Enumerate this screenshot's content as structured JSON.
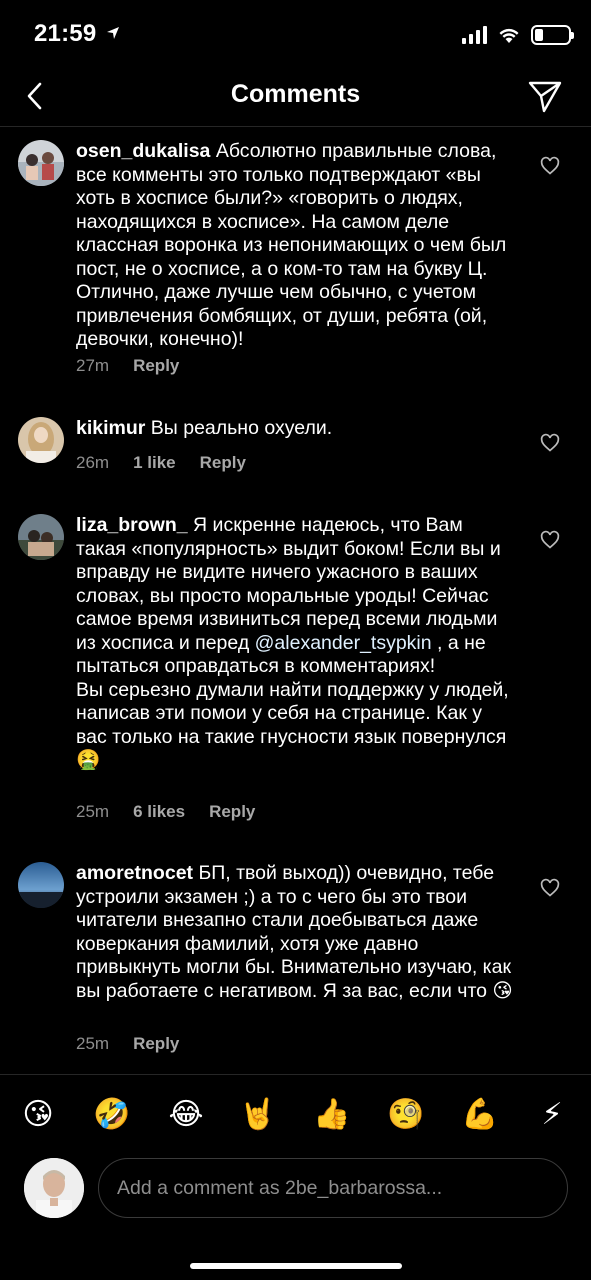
{
  "status_bar": {
    "time": "21:59",
    "battery_level": 0.25
  },
  "header": {
    "title": "Comments"
  },
  "comments": [
    {
      "user": "osen_dukalisa",
      "text": "Абсолютно правильные слова, все комменты это только подтверждают «вы хоть в хосписе были?» «говорить о людях, находящихся в хосписе». На самом деле классная воронка из непонимающих о чем был пост, не о хосписе, а о ком-то там на букву Ц. Отлично, даже лучше чем обычно, с учетом привлечения бомбящих, от души, ребята (ой, девочки, конечно)!",
      "time": "27m",
      "likes": "",
      "reply_label": "Reply"
    },
    {
      "user": "kikimur",
      "text": "Вы реально охуели.",
      "time": "26m",
      "likes": "1 like",
      "reply_label": "Reply"
    },
    {
      "user": "liza_brown_",
      "text": "Я искренне надеюсь, что Вам такая «популярность» выдит боком! Если вы и вправду не видите ничего ужасного в ваших словах, вы просто моральные уроды! Сейчас самое время извиниться перед всеми людьми из хосписа и перед",
      "mention": "@alexander_tsypkin",
      "text_after_mention": " , а не пытаться оправдаться в комментариях!",
      "text_2": "Вы серьезно думали найти поддержку у людей, написав эти помои у себя на странице. Как у вас только на такие гнусности язык повернулся🤮",
      "time": "25m",
      "likes": "6 likes",
      "reply_label": "Reply"
    },
    {
      "user": "amoretnocet",
      "text": "БП, твой выход)) очевидно, тебе устроили экзамен ;) а то с чего бы это твои читатели внезапно стали доебываться даже коверкания фамилий, хотя уже давно привыкнуть могли бы. Внимательно изучаю, как вы работаете с негативом. Я за вас, если что 😘",
      "time": "25m",
      "likes": "",
      "reply_label": "Reply"
    }
  ],
  "emoji_bar": [
    "😘",
    "🤣",
    "😂",
    "🤘",
    "👍",
    "🧐",
    "💪",
    "⚡"
  ],
  "composer": {
    "placeholder": "Add a comment as 2be_barbarossa..."
  },
  "icons": {
    "back": "chevron-left-icon",
    "send": "paper-plane-icon",
    "heart": "heart-outline-icon"
  }
}
